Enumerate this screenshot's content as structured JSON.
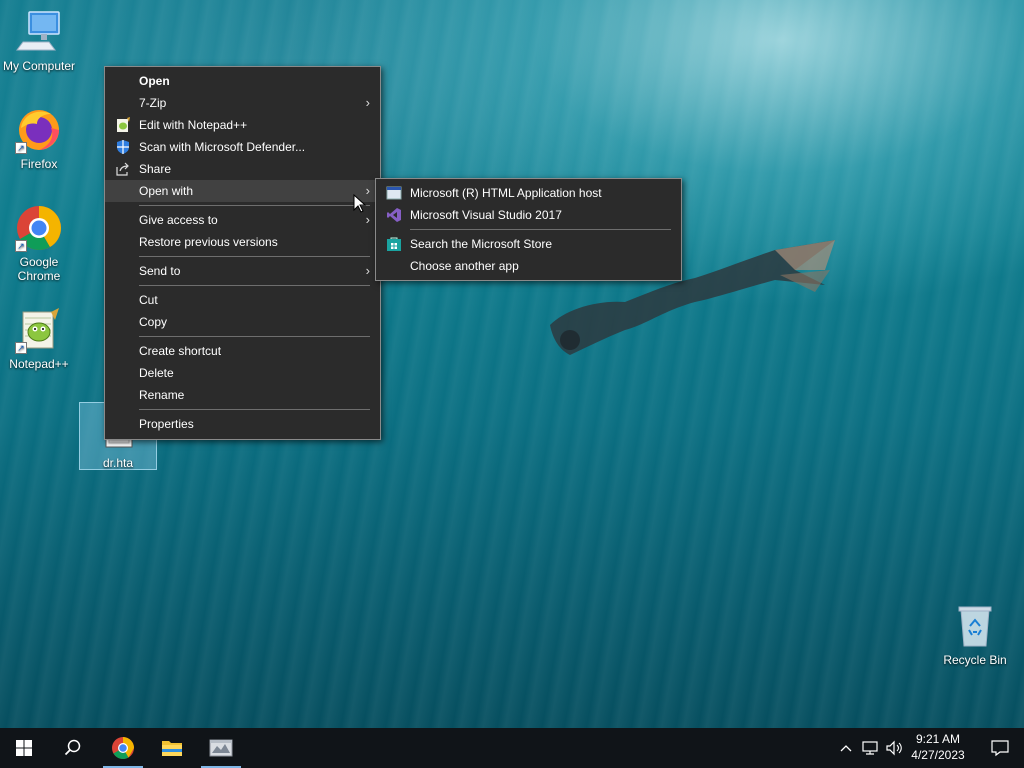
{
  "desktop": {
    "icons": [
      {
        "label": "My Computer",
        "icon": "computer-icon"
      },
      {
        "label": "Firefox",
        "icon": "firefox-icon"
      },
      {
        "label": "Google Chrome",
        "icon": "chrome-icon"
      },
      {
        "label": "Notepad++",
        "icon": "notepadpp-icon"
      },
      {
        "label": "dr.hta",
        "icon": "hta-file-icon"
      },
      {
        "label": "Recycle Bin",
        "icon": "recycle-bin-icon"
      }
    ]
  },
  "context_menu": {
    "items": {
      "open": "Open",
      "zip": "7-Zip",
      "notepadpp": "Edit with Notepad++",
      "defender": "Scan with Microsoft Defender...",
      "share": "Share",
      "open_with": "Open with",
      "give_access": "Give access to",
      "restore": "Restore previous versions",
      "send_to": "Send to",
      "cut": "Cut",
      "copy": "Copy",
      "create_shortcut": "Create shortcut",
      "delete": "Delete",
      "rename": "Rename",
      "properties": "Properties"
    }
  },
  "open_with_submenu": {
    "items": {
      "hta_host": "Microsoft (R) HTML Application host",
      "vs2017": "Microsoft Visual Studio 2017",
      "store": "Search the Microsoft Store",
      "choose": "Choose another app"
    }
  },
  "taskbar": {
    "clock_time": "9:21 AM",
    "clock_date": "4/27/2023"
  },
  "colors": {
    "menu_bg": "#2b2b2b",
    "menu_hover": "#414141",
    "taskbar_bg": "#101418",
    "accent": "#0078d7"
  }
}
